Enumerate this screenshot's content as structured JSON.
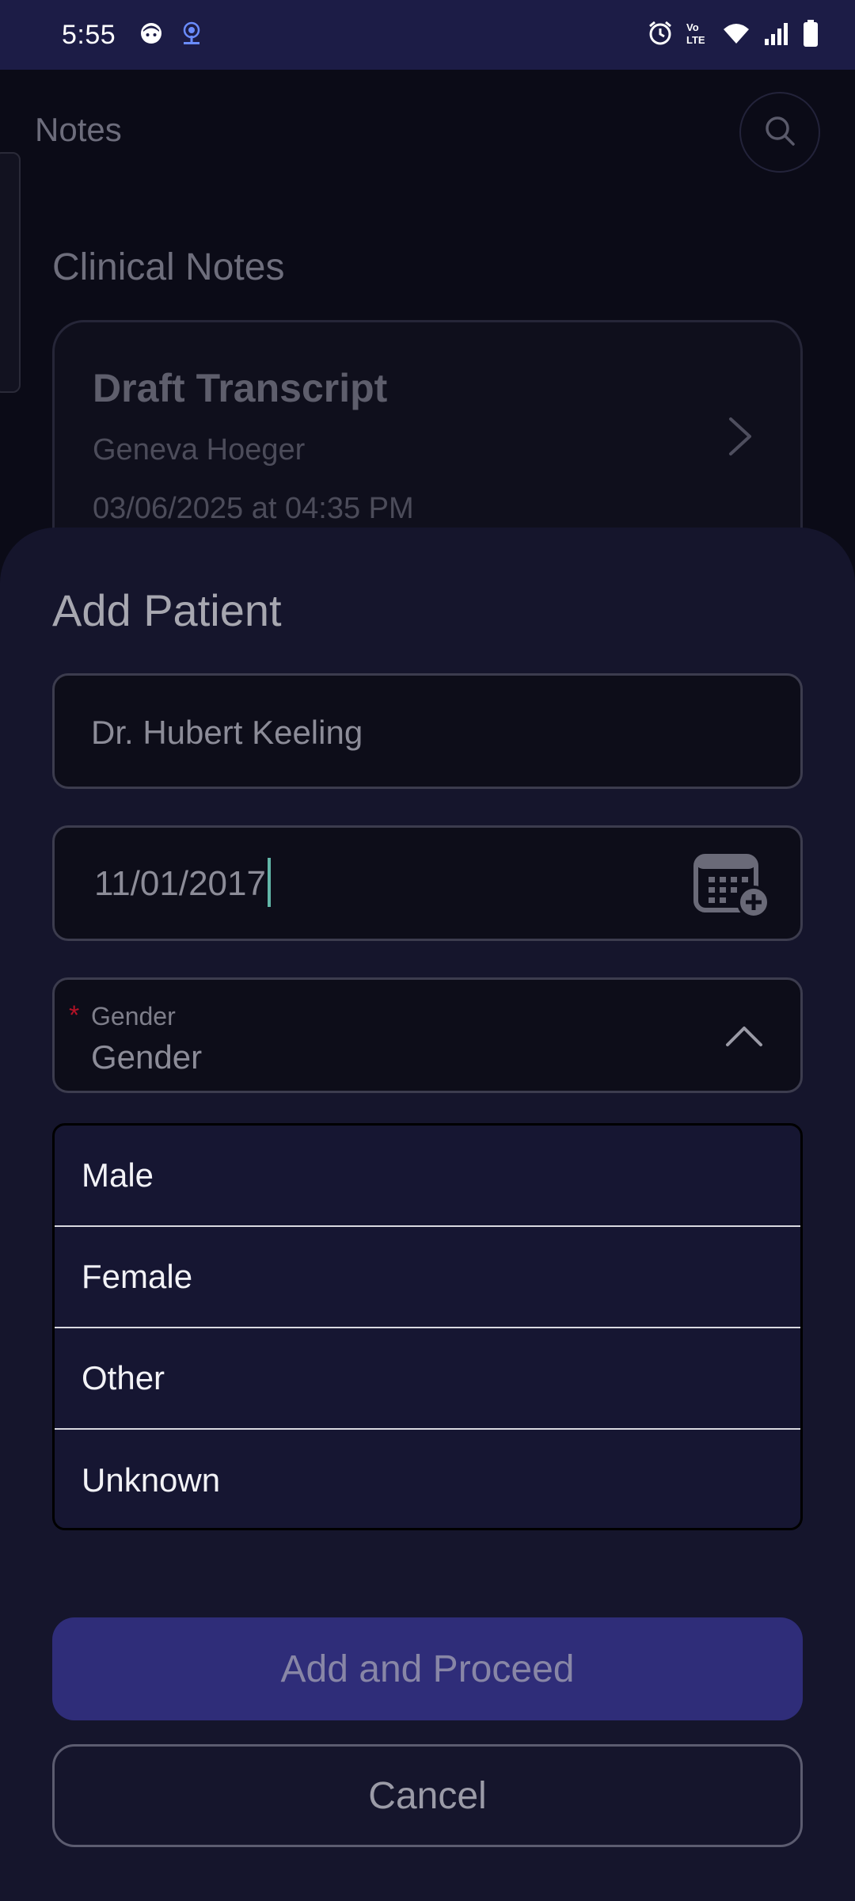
{
  "status_bar": {
    "time": "5:55",
    "left_icons": [
      "face-icon",
      "hotspot-icon"
    ],
    "right_icons": [
      "alarm-icon",
      "volte-icon",
      "wifi-icon",
      "signal-icon",
      "battery-icon"
    ],
    "volte_text": "Vo LTE"
  },
  "background": {
    "page_title": "Notes",
    "section_title": "Clinical Notes",
    "card": {
      "title": "Draft Transcript",
      "patient": "Geneva Hoeger",
      "date": "03/06/2025 at 04:35 PM"
    }
  },
  "sheet": {
    "title": "Add Patient",
    "name_value": "Dr. Hubert Keeling",
    "dob_value": "11/01/2017",
    "gender_label": "Gender",
    "gender_required_marker": "*",
    "gender_value": "Gender",
    "gender_options": [
      "Male",
      "Female",
      "Other",
      "Unknown"
    ],
    "primary_button": "Add and Proceed",
    "cancel_button": "Cancel"
  },
  "colors": {
    "status_bar_bg": "#1c1c46",
    "sheet_bg": "#15152c",
    "dropdown_bg": "#161632",
    "primary_button_bg": "#2f2d79",
    "required_red": "#b31227",
    "caret": "#62b6a8"
  }
}
